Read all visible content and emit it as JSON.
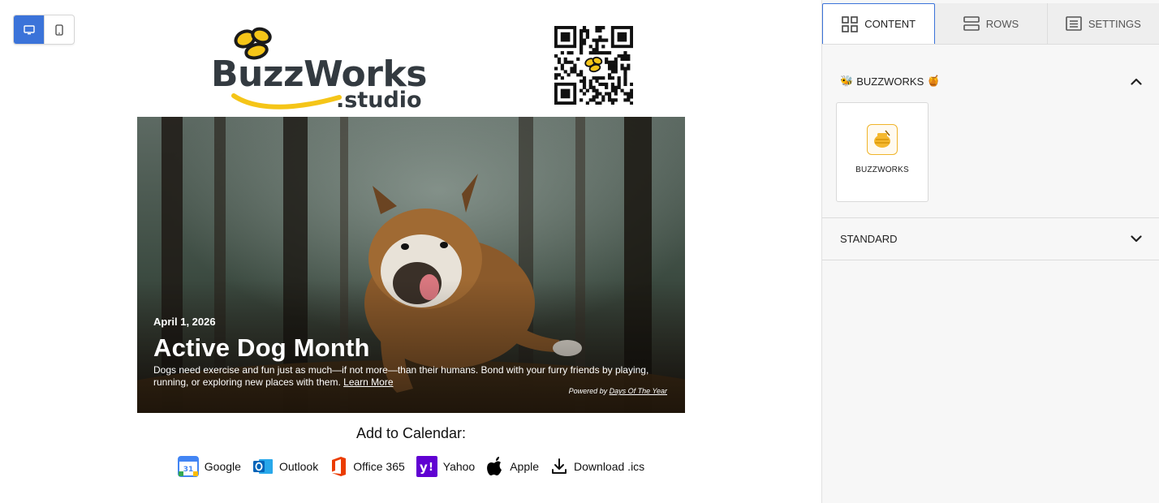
{
  "device_toggle": {
    "desktop_icon": "desktop-icon",
    "mobile_icon": "mobile-icon",
    "active": "desktop"
  },
  "brand": {
    "logo_word": "BuzzWorks",
    "logo_suffix": ".studio",
    "qr_icon": "qr-code-icon",
    "colors": {
      "text": "#333a40",
      "yellow": "#f5c518",
      "black": "#111111"
    }
  },
  "hero": {
    "date": "April 1, 2026",
    "title": "Active Dog Month",
    "description": "Dogs need exercise and fun just as much—if not more—than their humans. Bond with your furry friends by playing, running, or exploring new places with them.",
    "learn_more": "Learn More",
    "powered_prefix": "Powered by",
    "powered_link": "Days Of The Year"
  },
  "calendar": {
    "title": "Add to Calendar:",
    "links": [
      {
        "label": "Google",
        "icon": "google-calendar-icon"
      },
      {
        "label": "Outlook",
        "icon": "outlook-icon"
      },
      {
        "label": "Office 365",
        "icon": "office365-icon"
      },
      {
        "label": "Yahoo",
        "icon": "yahoo-icon"
      },
      {
        "label": "Apple",
        "icon": "apple-icon"
      },
      {
        "label": "Download .ics",
        "icon": "download-icon"
      }
    ]
  },
  "panel": {
    "tabs": [
      {
        "label": "CONTENT",
        "icon": "grid-icon",
        "active": true
      },
      {
        "label": "ROWS",
        "icon": "rows-icon",
        "active": false
      },
      {
        "label": "SETTINGS",
        "icon": "settings-list-icon",
        "active": false
      }
    ],
    "sections": [
      {
        "label": "BUZZWORKS",
        "prefix_emoji": "🐝",
        "suffix_emoji": "🍯",
        "expanded": true,
        "blocks": [
          {
            "label": "BUZZWORKS",
            "icon": "honey-pot-icon"
          }
        ]
      },
      {
        "label": "STANDARD",
        "expanded": false
      }
    ],
    "accent": "#3b73d9"
  }
}
